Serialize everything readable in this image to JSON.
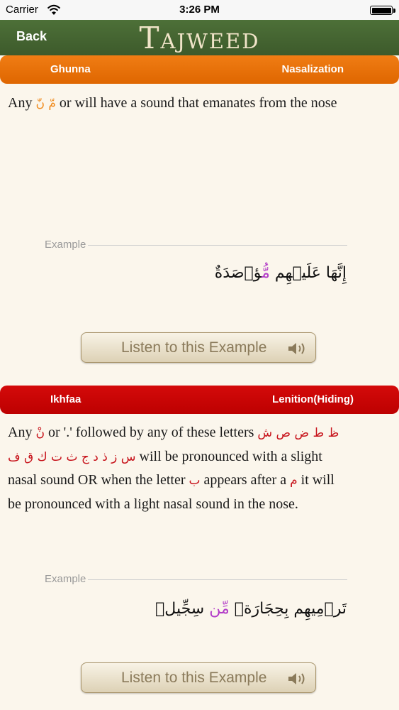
{
  "status_bar": {
    "carrier": "Carrier",
    "time": "3:26 PM",
    "icons": [
      "wifi-icon",
      "battery-icon"
    ]
  },
  "nav": {
    "back_label": "Back",
    "title": "Tajweed",
    "bar_color": "#456330"
  },
  "sections": [
    {
      "name": "Ghunna",
      "translation": "Nasalization",
      "color": "#ea7308",
      "description": {
        "part1": "Any",
        "letters": "مّ نّ",
        "part2": "or",
        "part3": "will have a sound that emanates from the nose"
      },
      "example_label": "Example",
      "example_arabic": {
        "part1": "إِنَّهَا عَلَيۡهِم",
        "highlight": "مُّ",
        "part2": "ؤۡصَدَةٌ"
      },
      "listen_label": "Listen to this Example"
    },
    {
      "name": "Ikhfaa",
      "translation": "Lenition(Hiding)",
      "color": "#c80707",
      "description": {
        "part1": "Any",
        "letter_nun": "نْ",
        "part2": "or '.' followed by any of these letters",
        "letters": "ظ ط ض ص ش س ز ذ د ج ث ت ك ق ف",
        "part3": "will be pronounced with a slight nasal sound OR when the letter",
        "letter_ba": "ب",
        "part4": "appears after a",
        "letter_mim": "م",
        "part5": "it will be pronounced with a light nasal sound in the nose."
      },
      "example_label": "Example",
      "example_arabic": {
        "part1": "تَرۡمِيهِم بِحِجَارَةٖ",
        "highlight": "مِّن",
        "part2": "سِجِّيلٖ"
      },
      "listen_label": "Listen to this Example"
    }
  ]
}
